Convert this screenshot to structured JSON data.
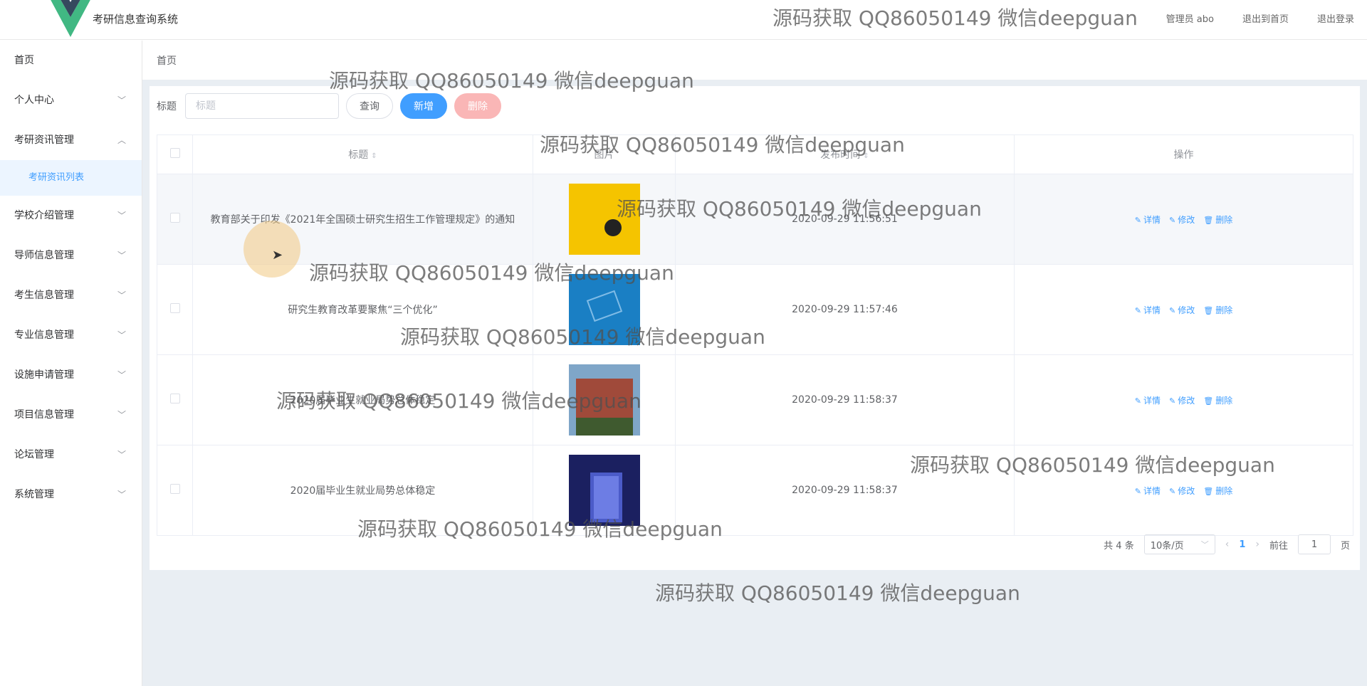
{
  "header": {
    "app_title": "考研信息查询系统",
    "user_label": "管理员 abo",
    "back_home": "退出到首页",
    "logout": "退出登录"
  },
  "sidebar": {
    "items": [
      {
        "label": "首页",
        "chevron": ""
      },
      {
        "label": "个人中心",
        "chevron": "﹀"
      },
      {
        "label": "考研资讯管理",
        "chevron": "︿"
      },
      {
        "label": "学校介绍管理",
        "chevron": "﹀"
      },
      {
        "label": "导师信息管理",
        "chevron": "﹀"
      },
      {
        "label": "考生信息管理",
        "chevron": "﹀"
      },
      {
        "label": "专业信息管理",
        "chevron": "﹀"
      },
      {
        "label": "设施申请管理",
        "chevron": "﹀"
      },
      {
        "label": "项目信息管理",
        "chevron": "﹀"
      },
      {
        "label": "论坛管理",
        "chevron": "﹀"
      },
      {
        "label": "系统管理",
        "chevron": "﹀"
      }
    ],
    "active_sub": "考研资讯列表"
  },
  "breadcrumb": "首页",
  "search": {
    "label": "标题",
    "placeholder": "标题",
    "query_btn": "查询",
    "add_btn": "新增",
    "delete_btn": "删除"
  },
  "table": {
    "columns": [
      "",
      "标题",
      "图片",
      "发布时间",
      "操作"
    ],
    "rows": [
      {
        "title": "教育部关于印发《2021年全国硕士研究生招生工作管理规定》的通知",
        "time": "2020-09-29 11:56:51",
        "img_color": "#f5c400"
      },
      {
        "title": "研究生教育改革要聚焦“三个优化”",
        "time": "2020-09-29 11:57:46",
        "img_color": "#1a7fc4"
      },
      {
        "title": "2020届毕业生就业局势总体稳定",
        "time": "2020-09-29 11:58:37",
        "img_color": "#a04a3a"
      },
      {
        "title": "2020届毕业生就业局势总体稳定",
        "time": "2020-09-29 11:58:37",
        "img_color": "#2a3a8a"
      }
    ],
    "op_detail": "详情",
    "op_edit": "修改",
    "op_delete": "删除"
  },
  "pager": {
    "total": "共 4 条",
    "page_size": "10条/页",
    "current": "1",
    "goto_label": "前往",
    "goto_value": "1",
    "page_unit": "页"
  },
  "watermark": "源码获取 QQ86050149 微信deepguan"
}
